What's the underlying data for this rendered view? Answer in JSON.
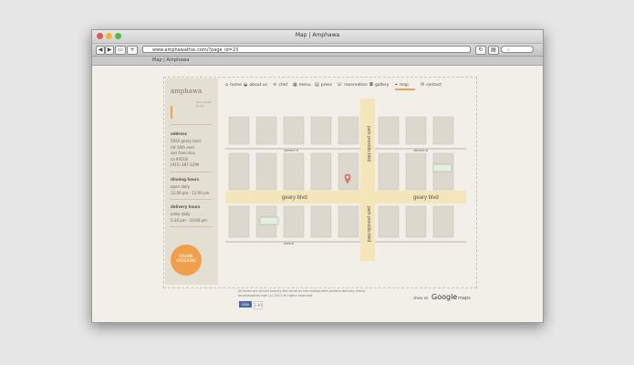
{
  "browser": {
    "window_title": "Map | Amphawa",
    "url": "www.amphawathai.com/?page_id=23",
    "tab_title": "Map | Amphawa",
    "back_icon": "◀",
    "forward_icon": "▶",
    "plus_icon": "+"
  },
  "sidebar": {
    "logo": "amphawa",
    "logo_sub": "thai noodle house",
    "address_heading": "address",
    "address_lines": [
      "5020 geary blvd.",
      "(at 14th ave)",
      "san francisco,",
      "ca 94118",
      "(415) 387-1299"
    ],
    "dining_heading": "dinning hours",
    "dining_lines": [
      "open daily",
      "12:00 pm - 11:00 pm"
    ],
    "delivery_heading": "delivery hours",
    "delivery_lines": [
      "order daily",
      "5:30 pm - 10:00 pm"
    ],
    "badge_text": "ONLINE ORDERING"
  },
  "nav": {
    "items": [
      {
        "label": "home",
        "icon": "home-icon"
      },
      {
        "label": "about us",
        "icon": "bowl-icon"
      },
      {
        "label": "chef",
        "icon": "chef-hat-icon"
      },
      {
        "label": "menu",
        "icon": "menu-icon"
      },
      {
        "label": "press",
        "icon": "newspaper-icon"
      },
      {
        "label": "reservation",
        "icon": "phone-icon"
      },
      {
        "label": "gallery",
        "icon": "camera-icon"
      },
      {
        "label": "map",
        "icon": "map-icon"
      },
      {
        "label": "contact",
        "icon": "envelope-icon"
      }
    ]
  },
  "map": {
    "street_geary_left": "geary blvd",
    "street_geary_right": "geary blvd",
    "street_clement_left": "clement st",
    "street_clement_right": "clement st",
    "street_anza": "anza st",
    "park_presidio_top": "park presidio blvd",
    "park_presidio_bottom": "park presidio blvd",
    "marker_color": "#e3726f",
    "accent": "#f0a04b"
  },
  "footer": {
    "note_line1": "all items are priced exactly the same as the restaurant's printed delivery menu.",
    "note_line2": "amphawathai.com (c) 2011 all rights reserved.",
    "like_label": "Like",
    "like_count": "130",
    "show_on": "show on",
    "google": "Google",
    "maps": "maps"
  }
}
